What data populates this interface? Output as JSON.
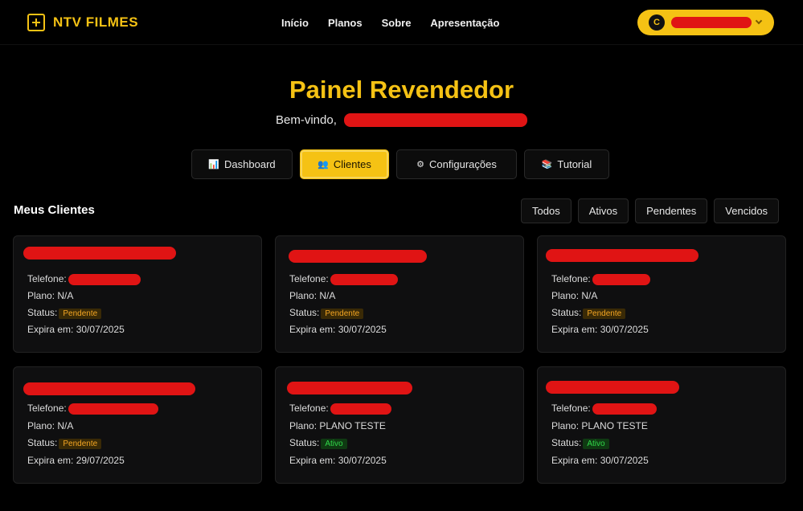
{
  "brand": {
    "name": "NTV FILMES",
    "icon": "plus-square-icon"
  },
  "nav": [
    "Início",
    "Planos",
    "Sobre",
    "Apresentação"
  ],
  "user": {
    "initial": "C"
  },
  "page": {
    "title": "Painel Revendedor",
    "welcome": "Bem-vindo,"
  },
  "tabs": [
    {
      "label": "Dashboard",
      "icon": "📊"
    },
    {
      "label": "Clientes",
      "icon": "👥"
    },
    {
      "label": "Configurações",
      "icon": "⚙"
    },
    {
      "label": "Tutorial",
      "icon": "📚"
    }
  ],
  "section": {
    "title": "Meus Clientes"
  },
  "filters": [
    "Todos",
    "Ativos",
    "Pendentes",
    "Vencidos"
  ],
  "labels": {
    "phone": "Telefone:",
    "plan": "Plano:",
    "status": "Status:",
    "expires": "Expira em:"
  },
  "clients": [
    {
      "plan": "N/A",
      "status": "Pendente",
      "expires": "30/07/2025"
    },
    {
      "plan": "N/A",
      "status": "Pendente",
      "expires": "30/07/2025"
    },
    {
      "plan": "N/A",
      "status": "Pendente",
      "expires": "30/07/2025"
    },
    {
      "plan": "N/A",
      "status": "Pendente",
      "expires": "29/07/2025"
    },
    {
      "plan": "PLANO TESTE",
      "status": "Ativo",
      "expires": "30/07/2025"
    },
    {
      "plan": "PLANO TESTE",
      "status": "Ativo",
      "expires": "30/07/2025"
    }
  ],
  "colors": {
    "accent": "#f5c214",
    "redaction": "#e01414",
    "pending": "#f5a623",
    "active": "#31d84a"
  }
}
